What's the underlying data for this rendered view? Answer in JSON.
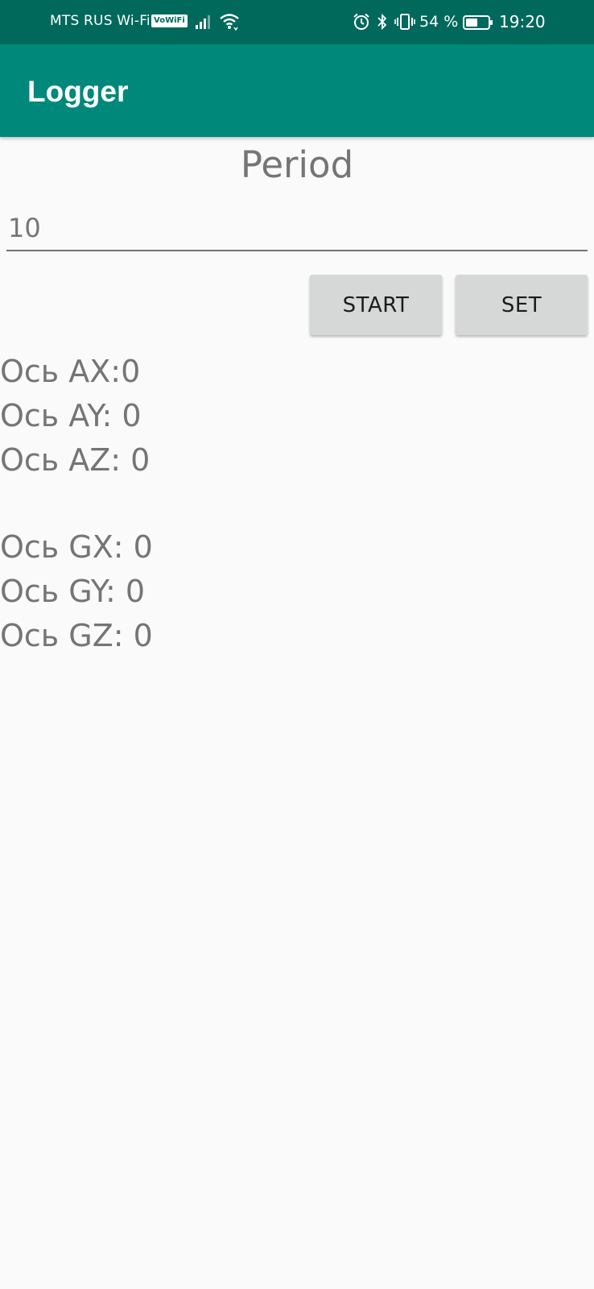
{
  "status_bar": {
    "carrier": "MTS RUS Wi-Fi",
    "volte_badge": "VoWiFi",
    "battery_percent": "54 %",
    "time": "19:20",
    "icons": [
      "signal-icon",
      "wifi-icon",
      "alarm-icon",
      "bluetooth-icon",
      "vibrate-icon",
      "battery-icon"
    ],
    "battery_level": 0.54
  },
  "app_bar": {
    "title": "Logger"
  },
  "form": {
    "period_label": "Period",
    "period_value": "10",
    "start_label": "START",
    "set_label": "SET"
  },
  "readings": {
    "ax": "Ось AX:0",
    "ay": "Ось AY: 0",
    "az": "Ось AZ: 0",
    "gx": "Ось GX: 0",
    "gy": "Ось GY: 0",
    "gz": "Ось GZ: 0"
  },
  "colors": {
    "status_bar": "#00695c",
    "app_bar": "#00897b",
    "background": "#fafafa",
    "button": "#d6d7d7",
    "text_secondary": "#757575"
  }
}
